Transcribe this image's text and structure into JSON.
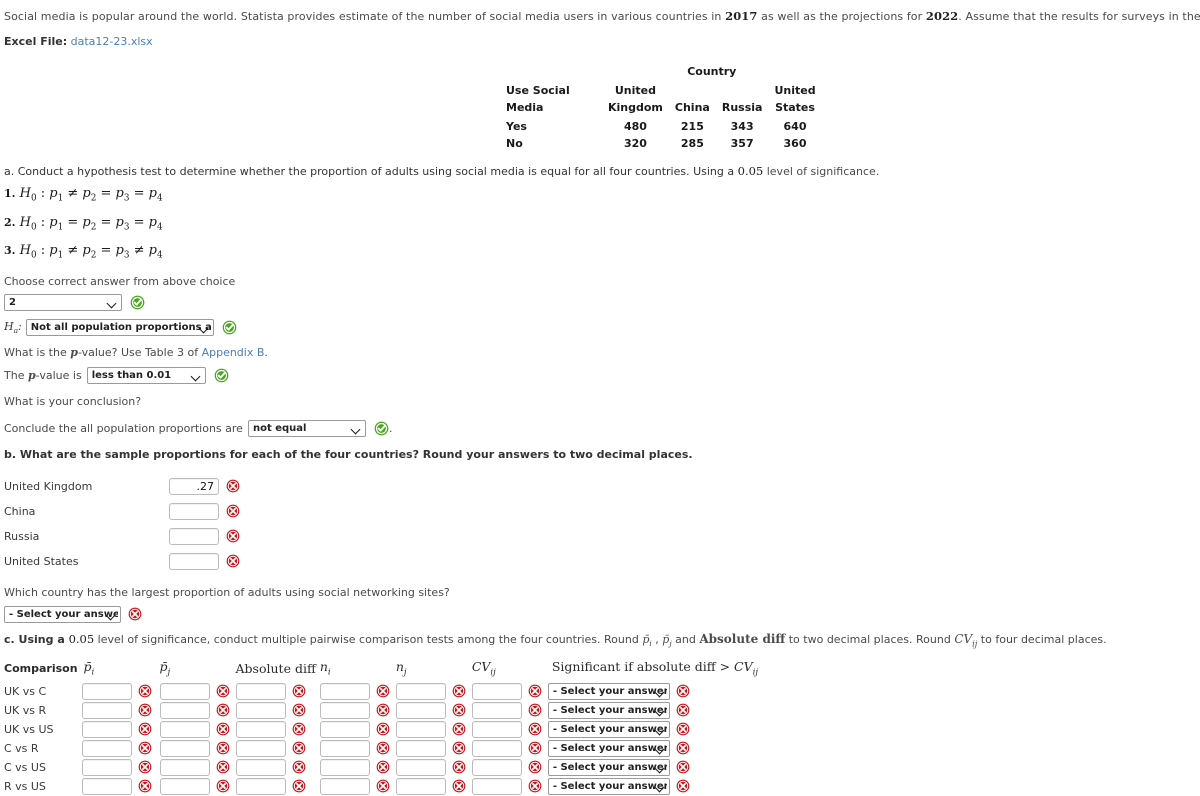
{
  "intro": {
    "text_parts": [
      "Social media is popular around the world. Statista provides estimate of the number of social media users in various countries in ",
      "2017",
      " as well as the projections for ",
      "2022",
      ". Assume that the results for surveys in the United Kingdom, China, Russia, and the United States are"
    ],
    "excel_label": "Excel File:",
    "excel_file": "data12-23.xlsx"
  },
  "data_table": {
    "country_header": "Country",
    "row_header_line1": "Use Social",
    "row_header_line2": "Media",
    "columns": [
      {
        "line1": "United",
        "line2": "Kingdom"
      },
      {
        "line1": "",
        "line2": "China"
      },
      {
        "line1": "",
        "line2": "Russia"
      },
      {
        "line1": "United",
        "line2": "States"
      }
    ],
    "rows": [
      {
        "label": "Yes",
        "values": [
          "480",
          "215",
          "343",
          "640"
        ]
      },
      {
        "label": "No",
        "values": [
          "320",
          "285",
          "357",
          "360"
        ]
      }
    ]
  },
  "part_a": {
    "prompt_prefix": "a. Conduct a hypothesis test to determine whether the proportion of adults using social media is equal for all four countries. Using a ",
    "alpha": "0.05",
    "prompt_suffix": " level of significance.",
    "hypotheses": [
      {
        "index": "1.",
        "text": "H₀ : p₁ ≠ p₂ = p₃ = p₄"
      },
      {
        "index": "2.",
        "text": "H₀ : p₁ = p₂ = p₃ = p₄"
      },
      {
        "index": "3.",
        "text": "H₀ : p₁ ≠ p₂ = p₃ ≠ p₄"
      }
    ],
    "choose_label": "Choose correct answer from above choice",
    "choice_value": "2",
    "choice_status": "correct",
    "ha_label": "H",
    "ha_sub": "a",
    "ha_colon": ":",
    "ha_value": "Not all population proportions are equal",
    "ha_status": "correct",
    "pvalue_question_pre": "What is the ",
    "pvalue_question_p": "p",
    "pvalue_question_post": "-value? Use Table 3 of ",
    "appendix_link": "Appendix B",
    "pvalue_question_end": ".",
    "pvalue_prefix_pre": "The ",
    "pvalue_prefix_p": "p",
    "pvalue_prefix_post": "-value is",
    "pvalue_value": "less than 0.01",
    "pvalue_status": "correct",
    "conclusion_question": "What is your conclusion?",
    "conclusion_prefix": "Conclude the all population proportions are",
    "conclusion_value": "not equal",
    "conclusion_status": "correct",
    "conclusion_period": "."
  },
  "part_b": {
    "prompt": "b. What are the sample proportions for each of the four countries? Round your answers to two decimal places.",
    "rows": [
      {
        "label": "United Kingdom",
        "value": ".27",
        "status": "incorrect"
      },
      {
        "label": "China",
        "value": "",
        "status": "incorrect"
      },
      {
        "label": "Russia",
        "value": "",
        "status": "incorrect"
      },
      {
        "label": "United States",
        "value": "",
        "status": "incorrect"
      }
    ],
    "largest_question": "Which country has the largest proportion of adults using social networking sites?",
    "largest_value": "- Select your answer -",
    "largest_status": "incorrect"
  },
  "part_c": {
    "prompt_pre": "c. Using a ",
    "alpha": "0.05",
    "prompt_mid": " level of significance, conduct multiple pairwise comparison tests among the four countries. Round ",
    "pbar_i": "p̄i",
    "prompt_comma": " , ",
    "pbar_j": "p̄j",
    "prompt_and": " and ",
    "absdiff_bold": "Absolute diff",
    "prompt_mid2": " to two decimal places. Round ",
    "cv_label": "CVij",
    "prompt_end": " to four decimal places.",
    "headers": {
      "comparison": "Comparison",
      "p_i": "p̄i",
      "p_j": "p̄j",
      "abs_diff": "Absolute diff",
      "n_i": "ni",
      "n_j": "nj",
      "cv": "CVij",
      "significant": "Significant if absolute diff > CVij"
    },
    "select_placeholder": "- Select your answer -",
    "rows": [
      {
        "label": "UK vs C",
        "p_i": "",
        "p_j": "",
        "abs_diff": "",
        "n_i": "",
        "n_j": "",
        "cv": "",
        "significant": "- Select your answer -"
      },
      {
        "label": "UK vs R",
        "p_i": "",
        "p_j": "",
        "abs_diff": "",
        "n_i": "",
        "n_j": "",
        "cv": "",
        "significant": "- Select your answer -"
      },
      {
        "label": "UK vs US",
        "p_i": "",
        "p_j": "",
        "abs_diff": "",
        "n_i": "",
        "n_j": "",
        "cv": "",
        "significant": "- Select your answer -"
      },
      {
        "label": "C vs R",
        "p_i": "",
        "p_j": "",
        "abs_diff": "",
        "n_i": "",
        "n_j": "",
        "cv": "",
        "significant": "- Select your answer -"
      },
      {
        "label": "C vs US",
        "p_i": "",
        "p_j": "",
        "abs_diff": "",
        "n_i": "",
        "n_j": "",
        "cv": "",
        "significant": "- Select your answer -"
      },
      {
        "label": "R vs US",
        "p_i": "",
        "p_j": "",
        "abs_diff": "",
        "n_i": "",
        "n_j": "",
        "cv": "",
        "significant": "- Select your answer -"
      }
    ]
  },
  "colors": {
    "teal_header": "#2cc3d6",
    "link_blue": "#4a7ebb",
    "correct_green": "#46a01e",
    "incorrect_red": "#c0191c",
    "body_text": "#4a4a4a"
  },
  "icons": {
    "correct": "check-circle-icon",
    "incorrect": "x-circle-icon",
    "dropdown": "chevron-down-icon"
  }
}
